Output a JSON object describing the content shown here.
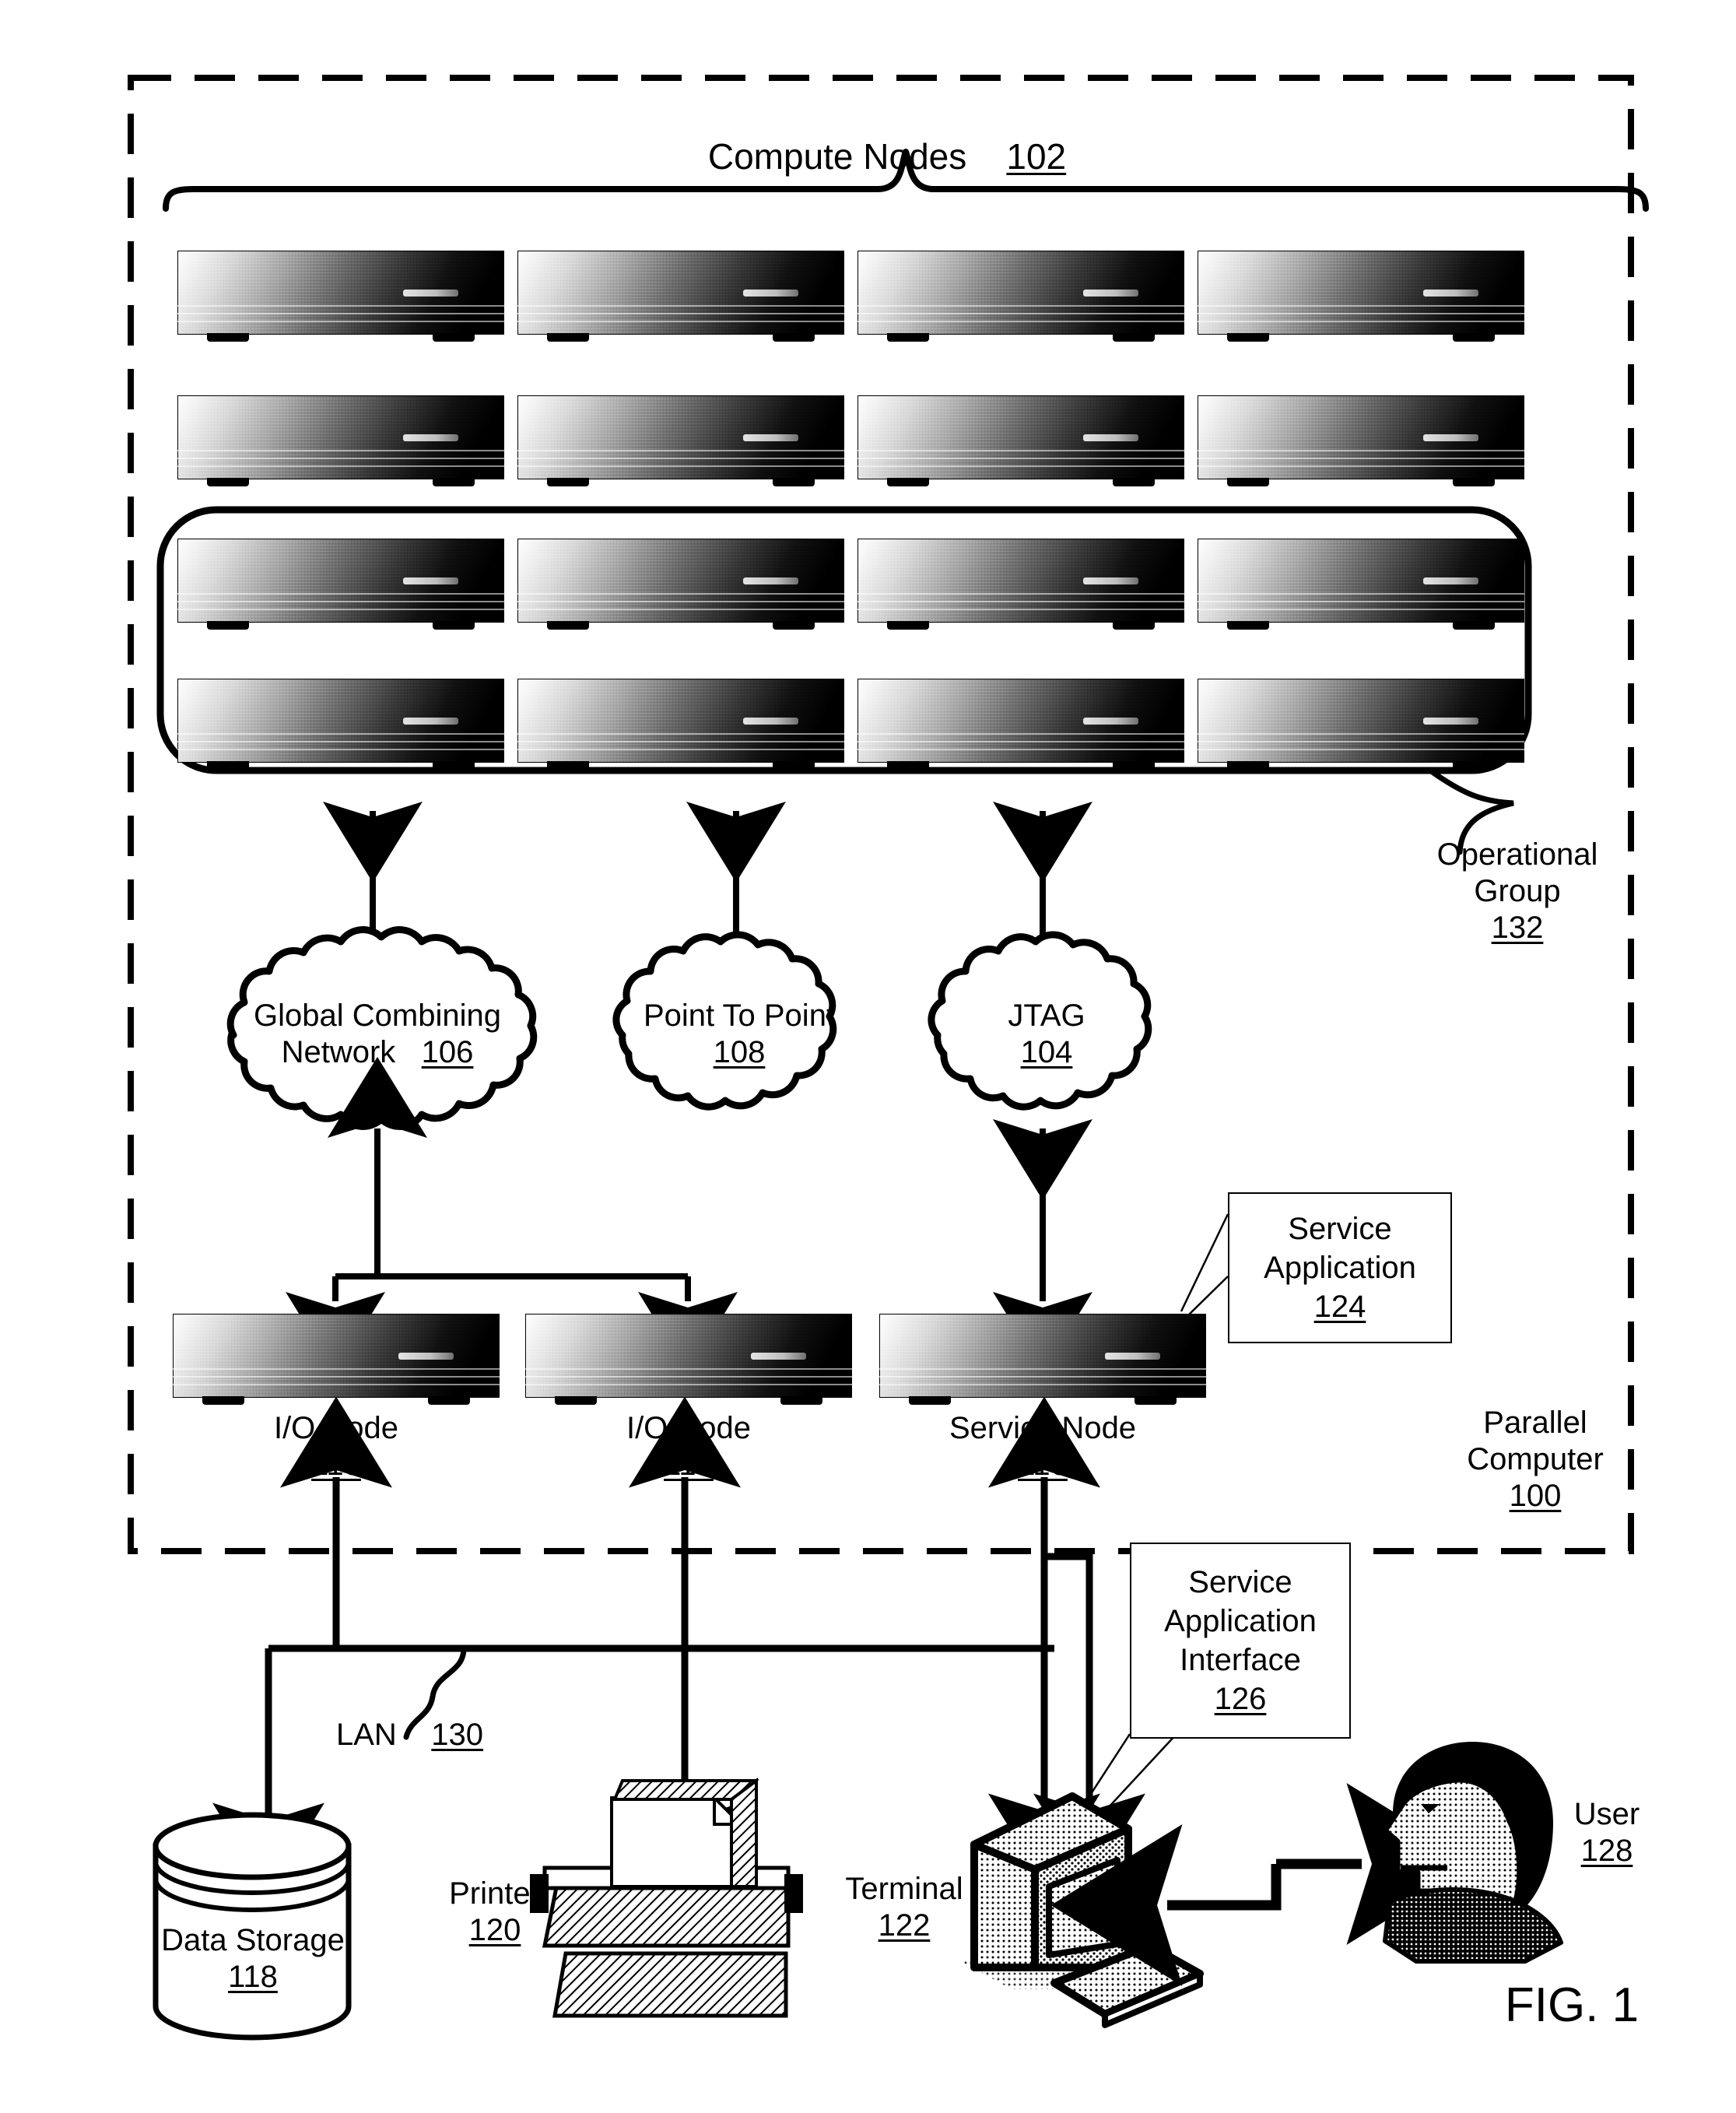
{
  "figure": {
    "caption": "FIG. 1"
  },
  "parallel_computer": {
    "label_line1": "Parallel",
    "label_line2": "Computer",
    "ref": "100"
  },
  "compute_nodes": {
    "label": "Compute Nodes",
    "ref": "102",
    "rows": 4,
    "columns": 4,
    "total": 16,
    "icon": "server-node-icon"
  },
  "operational_group": {
    "label_line1": "Operational",
    "label_line2": "Group",
    "ref": "132",
    "contains_rows": 2,
    "contains_nodes": 8
  },
  "networks": [
    {
      "name": "global-combining-network",
      "line1": "Global Combining",
      "line2": "Network",
      "ref": "106",
      "shape": "cloud-icon"
    },
    {
      "name": "point-to-point-network",
      "line1": "Point To Point",
      "line2": "",
      "ref": "108",
      "shape": "cloud-icon"
    },
    {
      "name": "jtag-network",
      "line1": "JTAG",
      "line2": "",
      "ref": "104",
      "shape": "cloud-icon"
    }
  ],
  "nodes": [
    {
      "name": "io-node-110",
      "label": "I/O Node",
      "ref": "110"
    },
    {
      "name": "io-node-114",
      "label": "I/O Node",
      "ref": "114"
    },
    {
      "name": "service-node",
      "label": "Service Node",
      "ref": "116"
    }
  ],
  "callouts": [
    {
      "name": "service-application",
      "line1": "Service",
      "line2": "Application",
      "line3": "",
      "ref": "124"
    },
    {
      "name": "service-application-interface",
      "line1": "Service",
      "line2": "Application",
      "line3": "Interface",
      "ref": "126"
    }
  ],
  "lan": {
    "label": "LAN",
    "ref": "130"
  },
  "peripherals": [
    {
      "name": "data-storage",
      "label": "Data Storage",
      "ref": "118",
      "icon": "cylinder-database-icon"
    },
    {
      "name": "printer",
      "label": "Printer",
      "ref": "120",
      "icon": "printer-icon"
    },
    {
      "name": "terminal",
      "label": "Terminal",
      "ref": "122",
      "icon": "crt-monitor-icon"
    },
    {
      "name": "user",
      "label": "User",
      "ref": "128",
      "icon": "person-head-icon"
    }
  ],
  "colors": {
    "ink": "#000000",
    "paper": "#ffffff"
  }
}
